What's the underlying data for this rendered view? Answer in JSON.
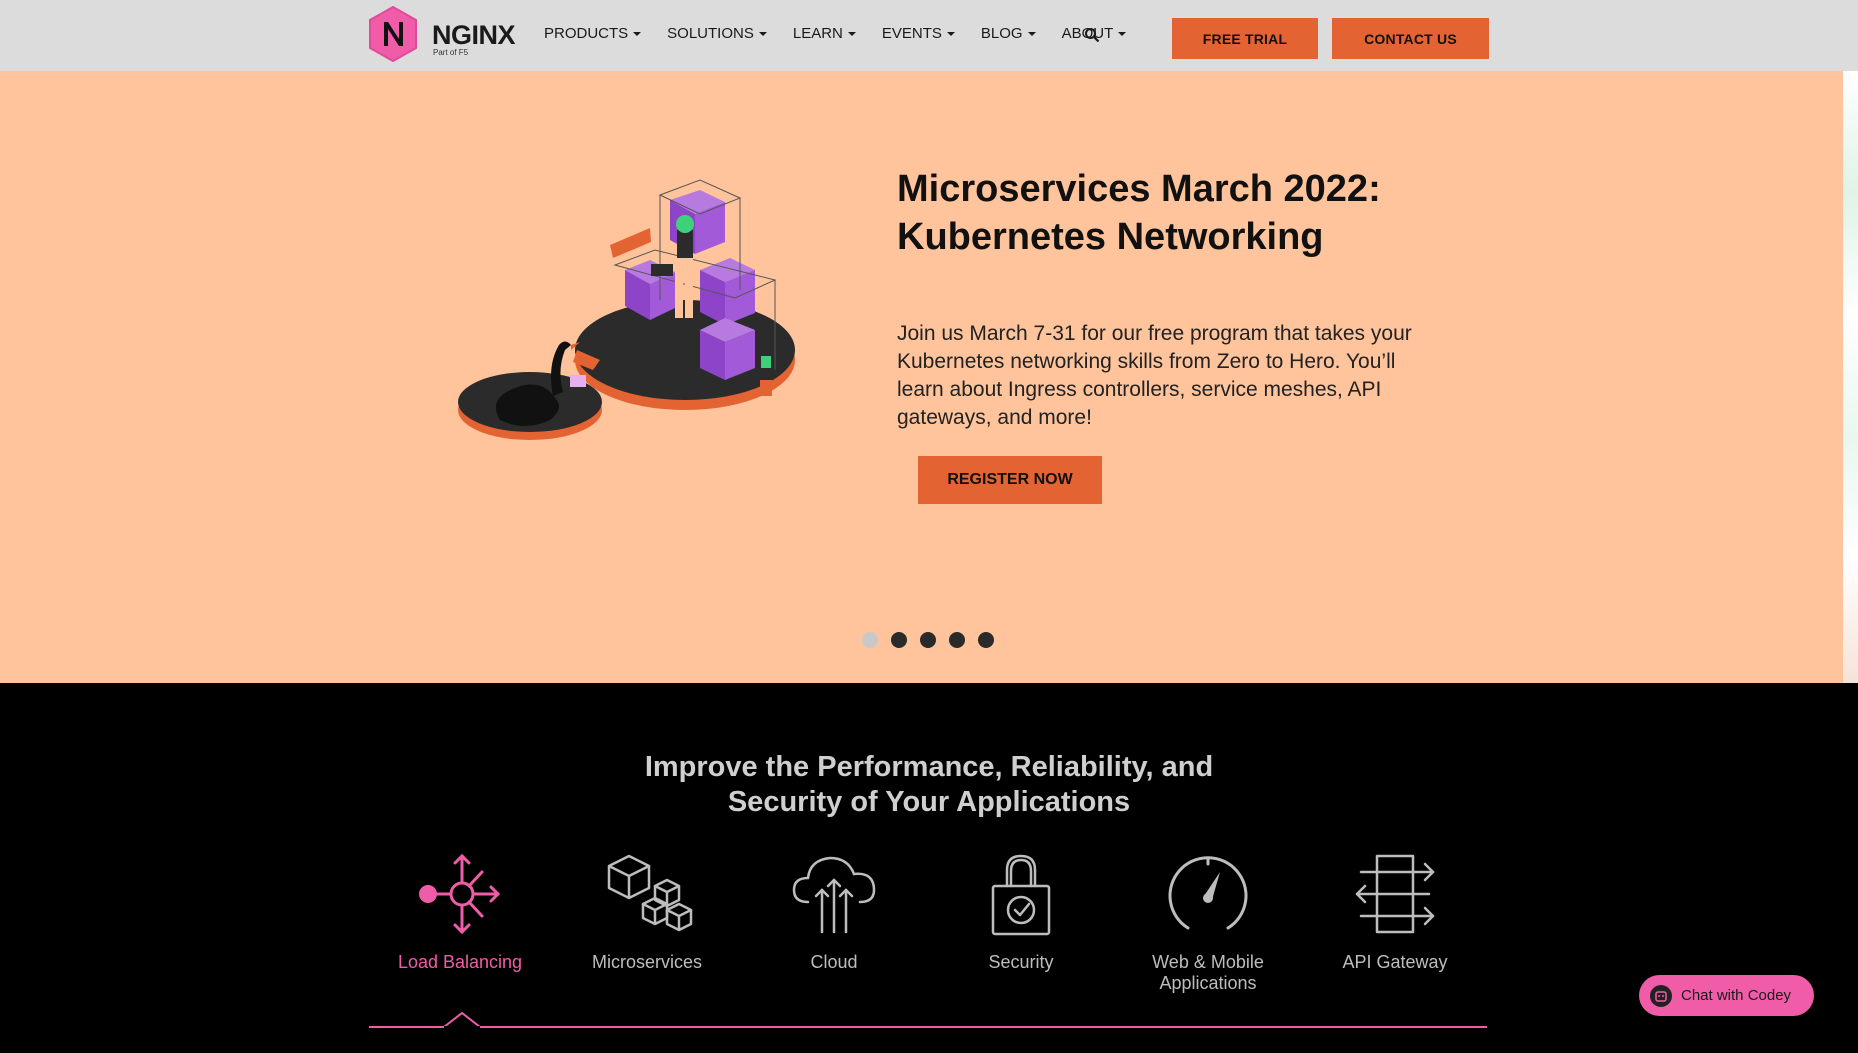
{
  "brand": {
    "name": "NGINX",
    "tagline": "Part of F5",
    "color": "#f15ca8"
  },
  "nav": {
    "items": [
      {
        "label": "PRODUCTS"
      },
      {
        "label": "SOLUTIONS"
      },
      {
        "label": "LEARN"
      },
      {
        "label": "EVENTS"
      },
      {
        "label": "BLOG"
      },
      {
        "label": "ABOUT"
      }
    ],
    "search_icon": "search-icon",
    "free_trial": "FREE TRIAL",
    "contact_us": "CONTACT US"
  },
  "hero": {
    "title": "Microservices March 2022: Kubernetes Networking",
    "text": "Join us March 7-31 for our free program that takes your Kubernetes networking skills from Zero to Hero. You’ll learn about Ingress controllers, service meshes, API gateways, and more!",
    "cta": "REGISTER NOW",
    "slides_total": 5,
    "active_slide": 1,
    "bg_color": "#ffc49c"
  },
  "section": {
    "heading_line1": "Improve the Performance, Reliability, and",
    "heading_line2": "Security of Your Applications",
    "features": [
      {
        "label": "Load Balancing",
        "icon": "load-balancing-icon",
        "active": true
      },
      {
        "label": "Microservices",
        "icon": "cubes-icon",
        "active": false
      },
      {
        "label": "Cloud",
        "icon": "cloud-upload-icon",
        "active": false
      },
      {
        "label": "Security",
        "icon": "lock-check-icon",
        "active": false
      },
      {
        "label": "Web & Mobile Applications",
        "icon": "gauge-icon",
        "active": false
      },
      {
        "label": "API Gateway",
        "icon": "arrows-exchange-icon",
        "active": false
      }
    ]
  },
  "chat": {
    "label": "Chat with Codey"
  },
  "colors": {
    "accent": "#e46332",
    "pink": "#f15ca8",
    "nav_bg": "#dcdcdc"
  }
}
